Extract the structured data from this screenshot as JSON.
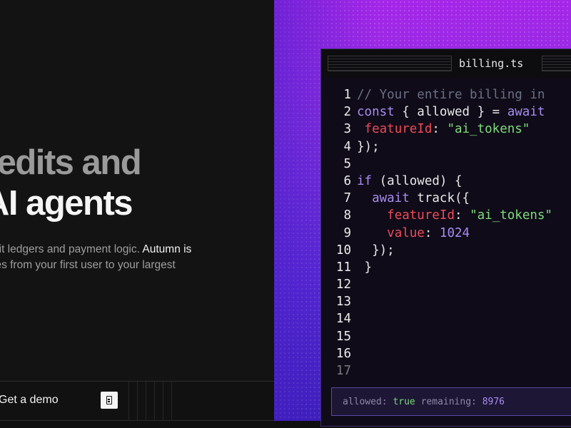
{
  "hero": {
    "headline_line1": "redits and",
    "headline_line2": "AI agents",
    "desc_line1_plain": "dit ledgers and payment logic.",
    "desc_line1_highlight": "Autumn is",
    "desc_line2": "les from your first user to your largest"
  },
  "bottom_bar": {
    "demo_label": "Get a demo",
    "demo_icon": "document-icon"
  },
  "editor": {
    "tab_title": "billing.ts",
    "code_lines": [
      {
        "n": "1",
        "parts": [
          {
            "t": "// Your entire billing in",
            "c": "cm"
          }
        ]
      },
      {
        "n": "2",
        "parts": [
          {
            "t": "const",
            "c": "kw"
          },
          {
            "t": " { allowed } = ",
            "c": ""
          },
          {
            "t": "await",
            "c": "kw"
          }
        ]
      },
      {
        "n": "3",
        "parts": [
          {
            "t": " ",
            "c": ""
          },
          {
            "t": "featureId",
            "c": "prop"
          },
          {
            "t": ": ",
            "c": ""
          },
          {
            "t": "\"ai_tokens\"",
            "c": "str"
          }
        ]
      },
      {
        "n": "4",
        "parts": [
          {
            "t": "});",
            "c": ""
          }
        ]
      },
      {
        "n": "5",
        "parts": []
      },
      {
        "n": "6",
        "parts": [
          {
            "t": "if",
            "c": "kw"
          },
          {
            "t": " (allowed) {",
            "c": ""
          }
        ]
      },
      {
        "n": "7",
        "parts": [
          {
            "t": "  ",
            "c": ""
          },
          {
            "t": "await",
            "c": "kw"
          },
          {
            "t": " track({",
            "c": ""
          }
        ]
      },
      {
        "n": "8",
        "parts": [
          {
            "t": "    ",
            "c": ""
          },
          {
            "t": "featureId",
            "c": "prop"
          },
          {
            "t": ": ",
            "c": ""
          },
          {
            "t": "\"ai_tokens\"",
            "c": "str"
          }
        ]
      },
      {
        "n": "9",
        "parts": [
          {
            "t": "    ",
            "c": ""
          },
          {
            "t": "value",
            "c": "prop"
          },
          {
            "t": ": ",
            "c": ""
          },
          {
            "t": "1024",
            "c": "num"
          }
        ]
      },
      {
        "n": "10",
        "parts": [
          {
            "t": "  });",
            "c": ""
          }
        ]
      },
      {
        "n": "11",
        "parts": [
          {
            "t": " }",
            "c": ""
          }
        ]
      },
      {
        "n": "12",
        "parts": []
      },
      {
        "n": "13",
        "parts": []
      },
      {
        "n": "14",
        "parts": []
      },
      {
        "n": "15",
        "parts": []
      },
      {
        "n": "16",
        "parts": []
      },
      {
        "n": "17",
        "parts": [],
        "dim": true
      }
    ],
    "result": {
      "allowed_label": "allowed:",
      "allowed_value": "true",
      "remaining_label": "remaining:",
      "remaining_value": "8976"
    }
  },
  "colors": {
    "background": "#131313",
    "accent_purple": "#8a2ee0",
    "keyword": "#a88cf2",
    "property": "#ef4b57",
    "string": "#7fdc7c"
  }
}
